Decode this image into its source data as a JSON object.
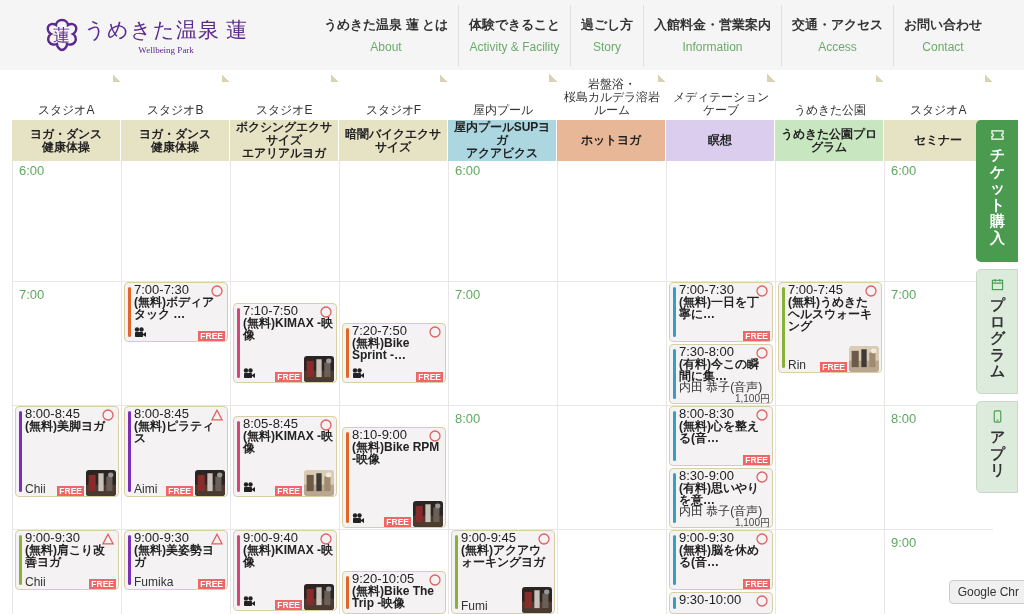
{
  "logo": {
    "mark": "蓮",
    "name": "うめきた温泉 蓮",
    "tagline": "Wellbeing Park"
  },
  "nav": [
    {
      "label": "うめきた温泉 蓮 とは",
      "sub": "About"
    },
    {
      "label": "体験できること",
      "sub": "Activity & Facility"
    },
    {
      "label": "過ごし方",
      "sub": "Story"
    },
    {
      "label": "入館料金・営業案内",
      "sub": "Information"
    },
    {
      "label": "交通・アクセス",
      "sub": "Access"
    },
    {
      "label": "お問い合わせ",
      "sub": "Contact"
    }
  ],
  "columns": [
    {
      "studio": [
        "スタジオA"
      ],
      "program": [
        "ヨガ・ダンス",
        "健康体操"
      ],
      "color": "#e6e2c4",
      "times": [
        "6:00",
        "7:00"
      ],
      "events": [
        {
          "time": "8:00-8:45",
          "few_left": false,
          "title": "(無料)美脚ヨガ",
          "instructor": "Chii",
          "badge": "FREE",
          "video": false,
          "photo": true,
          "color": "#7b2fb8"
        },
        {
          "time": "9:00-9:30",
          "few_left": true,
          "title": "(無料)肩こり改善ヨガ",
          "instructor": "Chii",
          "badge": "FREE",
          "video": false,
          "photo": false,
          "color": "#8ab03a"
        }
      ]
    },
    {
      "studio": [
        "スタジオB"
      ],
      "program": [
        "ヨガ・ダンス",
        "健康体操"
      ],
      "color": "#e6e2c4",
      "events": [
        {
          "time": "7:00-7:30",
          "few_left": false,
          "title": "(無料)ボディアタック …",
          "badge": "FREE",
          "video": true,
          "photo": false,
          "color": "#e0672c"
        },
        {
          "time": "8:00-8:45",
          "few_left": true,
          "title": "(無料)ピラティス",
          "instructor": "Aimi",
          "badge": "FREE",
          "video": false,
          "photo": true,
          "color": "#7b2fb8"
        },
        {
          "time": "9:00-9:30",
          "few_left": true,
          "title": "(無料)美姿勢ヨガ",
          "instructor": "Fumika",
          "badge": "FREE",
          "video": false,
          "photo": false,
          "color": "#7b2fb8"
        }
      ]
    },
    {
      "studio": [
        "スタジオE"
      ],
      "program": [
        "ボクシングエクササイズ",
        "エアリアルヨガ"
      ],
      "color": "#e6e2c4",
      "events": [
        {
          "time": "7:10-7:50",
          "few_left": false,
          "title": "(無料)KIMAX -映像",
          "badge": "FREE",
          "video": true,
          "photo": true,
          "color": "#d6457a"
        },
        {
          "time": "8:05-8:45",
          "few_left": false,
          "title": "(無料)KIMAX -映像",
          "badge": "FREE",
          "video": true,
          "photo": true,
          "color": "#d6457a"
        },
        {
          "time": "9:00-9:40",
          "few_left": false,
          "title": "(無料)KIMAX -映像",
          "badge": "FREE",
          "video": true,
          "photo": true,
          "color": "#d6457a"
        }
      ]
    },
    {
      "studio": [
        "スタジオF"
      ],
      "program": [
        "暗闇バイクエクササイズ"
      ],
      "color": "#e6e2c4",
      "events": [
        {
          "time": "7:20-7:50",
          "few_left": false,
          "title": "(無料)Bike Sprint -…",
          "badge": "FREE",
          "video": true,
          "photo": false,
          "color": "#e0672c"
        },
        {
          "time": "8:10-9:00",
          "few_left": false,
          "title": "(無料)Bike RPM -映像",
          "badge": "FREE",
          "video": true,
          "photo": true,
          "color": "#e0672c"
        },
        {
          "time": "9:20-10:05",
          "few_left": false,
          "title": "(無料)Bike The Trip -映像",
          "video": false,
          "photo": false,
          "color": "#e0672c"
        }
      ]
    },
    {
      "studio": [
        "屋内プール"
      ],
      "program": [
        "屋内プールSUPヨガ",
        "アクアビクス"
      ],
      "color": "#acd7e0",
      "times": [
        "6:00",
        "7:00",
        "8:00"
      ],
      "events": [
        {
          "time": "9:00-9:45",
          "few_left": false,
          "title": "(無料)アクアウォーキングヨガ",
          "instructor": "Fumi",
          "video": false,
          "photo": true,
          "color": "#8ab03a"
        }
      ]
    },
    {
      "studio": [
        "岩盤浴・",
        "桜島カルデラ溶岩ルーム"
      ],
      "program": [
        "ホットヨガ"
      ],
      "color": "#e8b797"
    },
    {
      "studio": [
        "メディテーションケーブ"
      ],
      "program": [
        "瞑想"
      ],
      "color": "#dacdee",
      "events": [
        {
          "time": "7:00-7:30",
          "few_left": false,
          "title": "(無料)一日を丁寧に…",
          "badge": "FREE",
          "video": false,
          "photo": false,
          "color": "#3a9cc4"
        },
        {
          "time": "7:30-8:00",
          "few_left": false,
          "title": "(有料)今この瞬間に集…",
          "instructor": "内田 恭子(音声)",
          "price": "1,100円",
          "video": false,
          "photo": false,
          "color": "#3a9cc4"
        },
        {
          "time": "8:00-8:30",
          "few_left": false,
          "title": "(無料)心を整える(音…",
          "badge": "FREE",
          "video": false,
          "photo": false,
          "color": "#3a9cc4"
        },
        {
          "time": "8:30-9:00",
          "few_left": false,
          "title": "(有料)思いやりを意…",
          "instructor": "内田 恭子(音声)",
          "price": "1,100円",
          "video": false,
          "photo": false,
          "color": "#3a9cc4"
        },
        {
          "time": "9:00-9:30",
          "few_left": false,
          "title": "(無料)脳を休める(音…",
          "badge": "FREE",
          "video": false,
          "photo": false,
          "color": "#3a9cc4"
        },
        {
          "time": "9:30-10:00",
          "few_left": false,
          "video": false,
          "photo": false,
          "color": "#3a9cc4"
        }
      ]
    },
    {
      "studio": [
        "うめきた公園"
      ],
      "program": [
        "うめきた公園プログラム"
      ],
      "color": "#c8e6c0",
      "events": [
        {
          "time": "7:00-7:45",
          "few_left": false,
          "title": "(無料)うめきたヘルスウォーキング",
          "instructor": "Rin",
          "badge": "FREE",
          "video": false,
          "photo": true,
          "color": "#8ab03a"
        }
      ]
    },
    {
      "studio": [
        "スタジオA"
      ],
      "program": [
        "セミナー"
      ],
      "color": "#e6e2c4",
      "times": [
        "6:00",
        "7:00",
        "8:00",
        "9:00"
      ]
    }
  ],
  "side_tabs": [
    {
      "kind": "ticket",
      "label": "チケット購入",
      "primary": true
    },
    {
      "kind": "calendar",
      "label": "プログラム",
      "primary": false
    },
    {
      "kind": "phone",
      "label": "アプリ",
      "primary": false
    }
  ],
  "tooltip": "Google Chr"
}
